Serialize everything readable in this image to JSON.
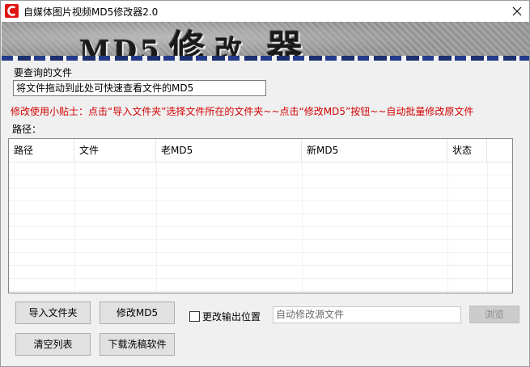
{
  "window": {
    "title": "自媒体图片视频MD5修改器2.0",
    "icon": "app-logo-icon",
    "accent_color": "#e01414"
  },
  "banner": {
    "title_md5": "MD5",
    "title_cn": "修改器",
    "title_cn_first": "修",
    "title_cn_second": "改",
    "title_cn_third": "器"
  },
  "query": {
    "label": "要查询的文件",
    "input_value": "将文件拖动到此处可快速查看文件的MD5"
  },
  "tip": {
    "text": "修改使用小贴士：点击“导入文件夹”选择文件所在的文件夹~~点击“修改MD5”按钮~~自动批量修改原文件",
    "color": "#d20000"
  },
  "path": {
    "label": "路径："
  },
  "table": {
    "columns": [
      "路径",
      "文件",
      "老MD5",
      "新MD5",
      "状态"
    ],
    "rows": []
  },
  "buttons": {
    "import_folder": "导入文件夹",
    "modify_md5": "修改MD5",
    "clear_list": "清空列表",
    "download_software": "下载洗稿软件",
    "browse": "浏览"
  },
  "output": {
    "checkbox_label": "更改输出位置",
    "checked": false,
    "input_value": "自动修改源文件"
  }
}
